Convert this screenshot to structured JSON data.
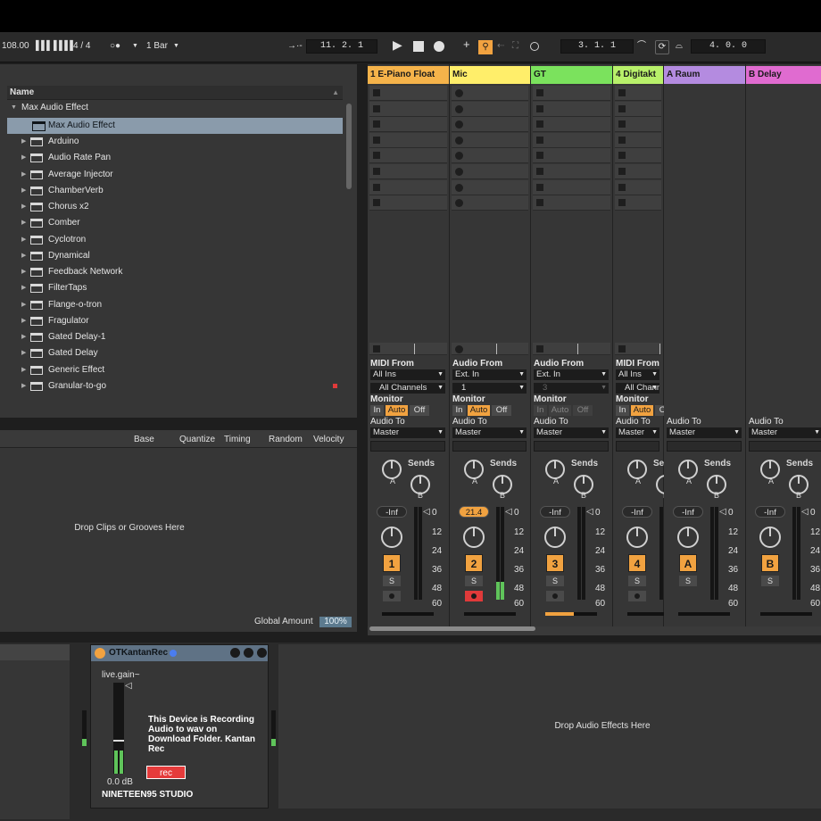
{
  "transport": {
    "tempo": "108.00",
    "signature": "4 / 4",
    "metronome": "○●",
    "quantize": "1 Bar",
    "position": "11.  2.  1",
    "punch_in": "3.  1.  1",
    "loop_length": "4.  0.  0"
  },
  "browser": {
    "header": "Name",
    "root": "Max Audio Effect",
    "selected": "Max Audio Effect",
    "items": [
      "Arduino",
      "Audio Rate Pan",
      "Average Injector",
      "ChamberVerb",
      "Chorus x2",
      "Comber",
      "Cyclotron",
      "Dynamical",
      "Feedback Network",
      "FilterTaps",
      "Flange-o-tron",
      "Fragulator",
      "Gated Delay-1",
      "Gated Delay",
      "Generic Effect",
      "Granular-to-go"
    ]
  },
  "groove": {
    "columns": [
      "Base",
      "Quantize",
      "Timing",
      "Random",
      "Velocity"
    ],
    "drop_text": "Drop Clips or Grooves Here",
    "global_amount_label": "Global Amount",
    "global_amount": "100%"
  },
  "tracks": [
    {
      "name": "1 E-Piano Float",
      "color": "#f5b34a",
      "from_label": "MIDI From",
      "from": "All Ins",
      "channel": "All Channels",
      "monitor_label": "Monitor",
      "to_label": "Audio To",
      "to": "Master",
      "volume": "-Inf",
      "number": "1"
    },
    {
      "name": "Mic",
      "color": "#ffee6a",
      "from_label": "Audio From",
      "from": "Ext. In",
      "channel": "1",
      "monitor_label": "Monitor",
      "to_label": "Audio To",
      "to": "Master",
      "volume": "21.4",
      "number": "2"
    },
    {
      "name": "GT",
      "color": "#7be25d",
      "from_label": "Audio From",
      "from": "Ext. In",
      "channel": "3",
      "monitor_label": "Monitor",
      "to_label": "Audio To",
      "to": "Master",
      "volume": "-Inf",
      "number": "3"
    },
    {
      "name": "4 Digitakt",
      "color": "#b8f06a",
      "from_label": "MIDI From",
      "from": "All Ins",
      "channel": "All Chann",
      "monitor_label": "Monitor",
      "to_label": "Audio To",
      "to": "Master",
      "volume": "-Inf",
      "number": "4"
    },
    {
      "name": "A Raum",
      "color": "#b48be0",
      "to_label": "Audio To",
      "to": "Master",
      "volume": "-Inf",
      "number": "A"
    },
    {
      "name": "B Delay",
      "color": "#e06bd0",
      "to_label": "Audio To",
      "to": "Master",
      "volume": "-Inf",
      "number": "B"
    }
  ],
  "monitor_opts": [
    "In",
    "Auto",
    "Off"
  ],
  "sends_label": "Sends",
  "send_a": "A",
  "send_b": "B",
  "solo": "S",
  "meter_scale": [
    "0",
    "12",
    "24",
    "36",
    "48",
    "60"
  ],
  "device": {
    "name": "OTKantanRec",
    "param": "live.gain~",
    "gain": "0.0 dB",
    "message": "This Device is Recording Audio to wav on Download Folder. Kantan Rec",
    "rec": "rec",
    "brand": "NINETEEN95 STUDIO",
    "drop_text": "Drop Audio Effects Here"
  }
}
